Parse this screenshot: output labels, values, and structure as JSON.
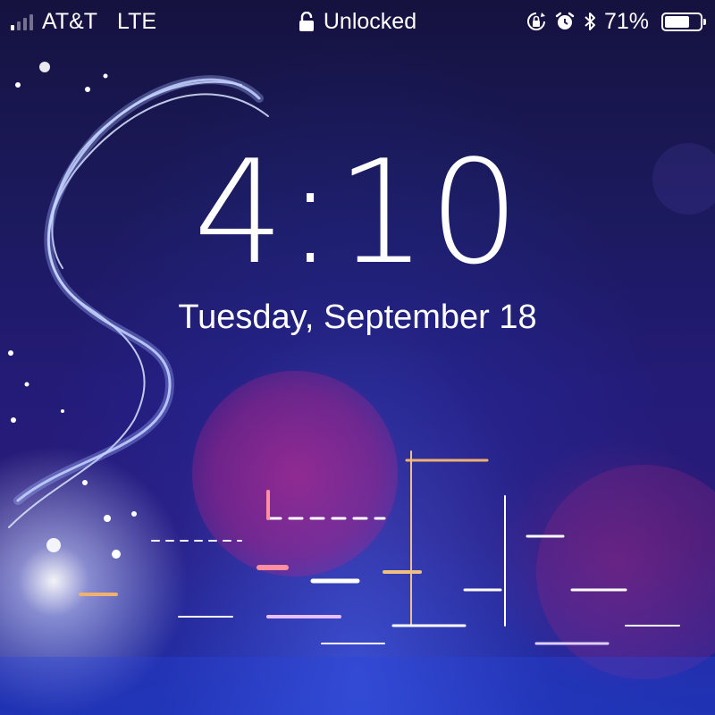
{
  "status_bar": {
    "carrier": "AT&T",
    "network": "LTE",
    "lock_status": "Unlocked",
    "battery_percent": "71%",
    "battery_level": 0.71,
    "signal_bars_filled": 1,
    "signal_bars_total": 4,
    "icons": [
      "signal-icon",
      "lock-icon",
      "orientation-lock-icon",
      "alarm-icon",
      "bluetooth-icon",
      "battery-icon"
    ]
  },
  "lockscreen": {
    "time": "4:10",
    "date": "Tuesday, September 18"
  },
  "colors": {
    "text": "#ffffff",
    "background_top": "#15123f",
    "background_bottom": "#1c2aa0",
    "accent_pink": "#be288c"
  }
}
